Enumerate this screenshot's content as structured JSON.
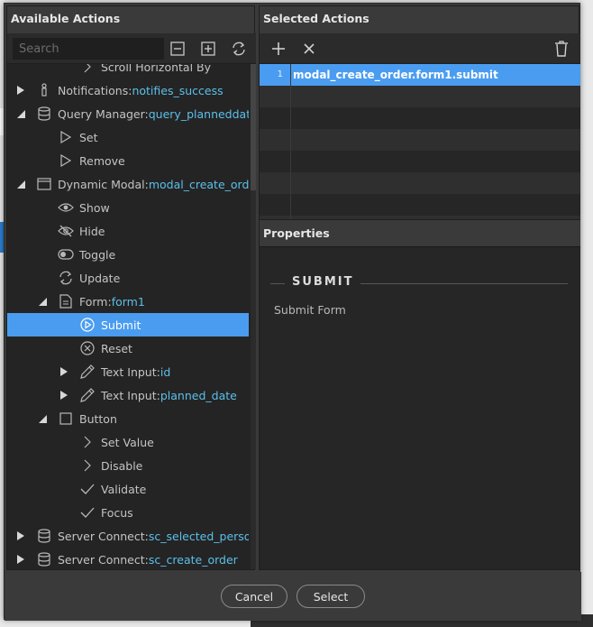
{
  "left_pane": {
    "title": "Available Actions",
    "search_placeholder": "Search",
    "tree": [
      {
        "label": "Scroll Horizontal By",
        "value": "",
        "indent": 3,
        "arrow": "",
        "icon": "chevron-right-icon",
        "selected": false
      },
      {
        "label": "Notifications: ",
        "value": "notifies_success",
        "indent": 1,
        "arrow": "collapsed",
        "icon": "notification-icon",
        "selected": false
      },
      {
        "label": "Query Manager: ",
        "value": "query_planneddate",
        "indent": 1,
        "arrow": "expanded",
        "icon": "database-icon",
        "selected": false
      },
      {
        "label": "Set",
        "value": "",
        "indent": 2,
        "arrow": "",
        "icon": "play-icon",
        "selected": false
      },
      {
        "label": "Remove",
        "value": "",
        "indent": 2,
        "arrow": "",
        "icon": "play-icon",
        "selected": false
      },
      {
        "label": "Dynamic Modal: ",
        "value": "modal_create_order",
        "indent": 1,
        "arrow": "expanded",
        "icon": "modal-icon",
        "selected": false
      },
      {
        "label": "Show",
        "value": "",
        "indent": 2,
        "arrow": "",
        "icon": "eye-icon",
        "selected": false
      },
      {
        "label": "Hide",
        "value": "",
        "indent": 2,
        "arrow": "",
        "icon": "eye-off-icon",
        "selected": false
      },
      {
        "label": "Toggle",
        "value": "",
        "indent": 2,
        "arrow": "",
        "icon": "toggle-icon",
        "selected": false
      },
      {
        "label": "Update",
        "value": "",
        "indent": 2,
        "arrow": "",
        "icon": "refresh-icon",
        "selected": false
      },
      {
        "label": "Form: ",
        "value": "form1",
        "indent": 2,
        "arrow": "expanded",
        "icon": "form-icon",
        "selected": false
      },
      {
        "label": "Submit",
        "value": "",
        "indent": 3,
        "arrow": "",
        "icon": "play-circle-icon",
        "selected": true
      },
      {
        "label": "Reset",
        "value": "",
        "indent": 3,
        "arrow": "",
        "icon": "close-circle-icon",
        "selected": false
      },
      {
        "label": "Text Input: ",
        "value": "id",
        "indent": 3,
        "arrow": "collapsed",
        "icon": "pencil-icon",
        "selected": false
      },
      {
        "label": "Text Input: ",
        "value": "planned_date",
        "indent": 3,
        "arrow": "collapsed",
        "icon": "pencil-icon",
        "selected": false
      },
      {
        "label": "Button",
        "value": "",
        "indent": 2,
        "arrow": "expanded",
        "icon": "checkbox-icon",
        "selected": false
      },
      {
        "label": "Set Value",
        "value": "",
        "indent": 3,
        "arrow": "",
        "icon": "chevron-right-icon",
        "selected": false
      },
      {
        "label": "Disable",
        "value": "",
        "indent": 3,
        "arrow": "",
        "icon": "chevron-right-icon",
        "selected": false
      },
      {
        "label": "Validate",
        "value": "",
        "indent": 3,
        "arrow": "",
        "icon": "check-icon",
        "selected": false
      },
      {
        "label": "Focus",
        "value": "",
        "indent": 3,
        "arrow": "",
        "icon": "check-icon",
        "selected": false
      },
      {
        "label": "Server Connect: ",
        "value": "sc_selected_person",
        "indent": 1,
        "arrow": "collapsed",
        "icon": "database-icon",
        "selected": false
      },
      {
        "label": "Server Connect: ",
        "value": "sc_create_order",
        "indent": 1,
        "arrow": "collapsed",
        "icon": "database-icon",
        "selected": false
      }
    ]
  },
  "right_pane": {
    "title": "Selected Actions",
    "selected_actions": [
      {
        "number": "1",
        "label": "modal_create_order.form1.submit"
      }
    ],
    "properties_title": "Properties",
    "properties": {
      "heading": "SUBMIT",
      "description": "Submit Form"
    }
  },
  "footer": {
    "cancel_label": "Cancel",
    "select_label": "Select"
  },
  "colors": {
    "accent": "#4a9cf0",
    "value_text": "#5bc0ea"
  }
}
